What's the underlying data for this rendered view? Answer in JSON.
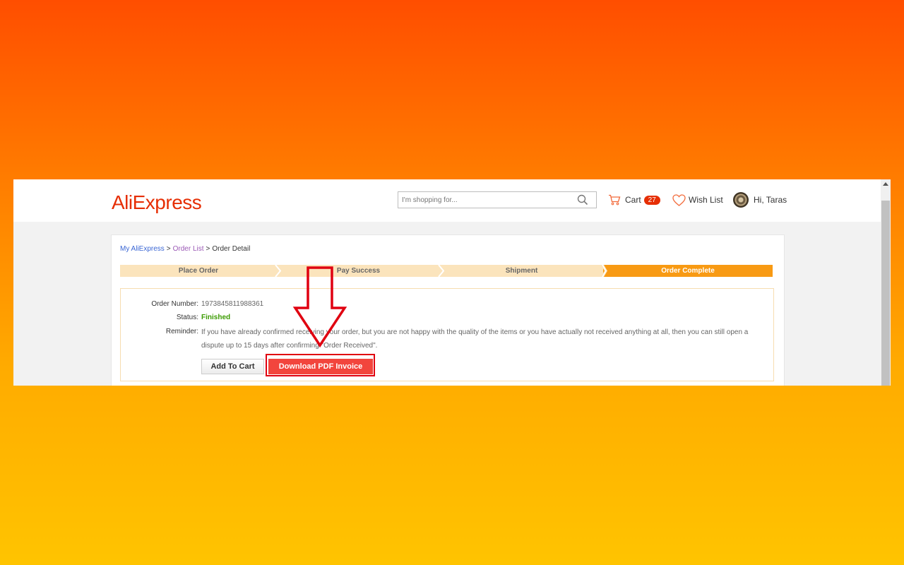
{
  "header": {
    "logo_text": "AliExpress",
    "search": {
      "placeholder": "I'm shopping for...",
      "value": ""
    },
    "cart": {
      "label": "Cart",
      "count": "27"
    },
    "wishlist": {
      "label": "Wish List"
    },
    "user": {
      "greeting": "Hi, Taras"
    }
  },
  "breadcrumb": [
    {
      "label": "My AliExpress"
    },
    {
      "label": "Order List"
    },
    {
      "label": "Order Detail"
    }
  ],
  "breadcrumb_separator": ">",
  "progress_steps": [
    {
      "label": "Place Order",
      "active": false
    },
    {
      "label": "Pay Success",
      "active": false
    },
    {
      "label": "Shipment",
      "active": false
    },
    {
      "label": "Order Complete",
      "active": true
    }
  ],
  "order": {
    "number_label": "Order Number:",
    "number": "1973845811988361",
    "status_label": "Status:",
    "status": "Finished",
    "reminder_label": "Reminder:",
    "reminder": "If you have already confirmed receiving your order, but you are not happy with the quality of the items or you have actually not received anything at all, then you can still open a dispute up to 15 days after confirming \"Order Received\"."
  },
  "actions": {
    "add_to_cart": "Add To Cart",
    "download_pdf": "Download PDF Invoice"
  },
  "colors": {
    "brand": "#e62e04",
    "step_inactive": "#fbe4bc",
    "step_active": "#f89a13",
    "status_green": "#3b9b00",
    "pdf_button": "#f2453d",
    "annotation_red": "#e00010"
  },
  "icons": [
    "search-icon",
    "cart-icon",
    "heart-icon",
    "down-arrow-annotation"
  ]
}
